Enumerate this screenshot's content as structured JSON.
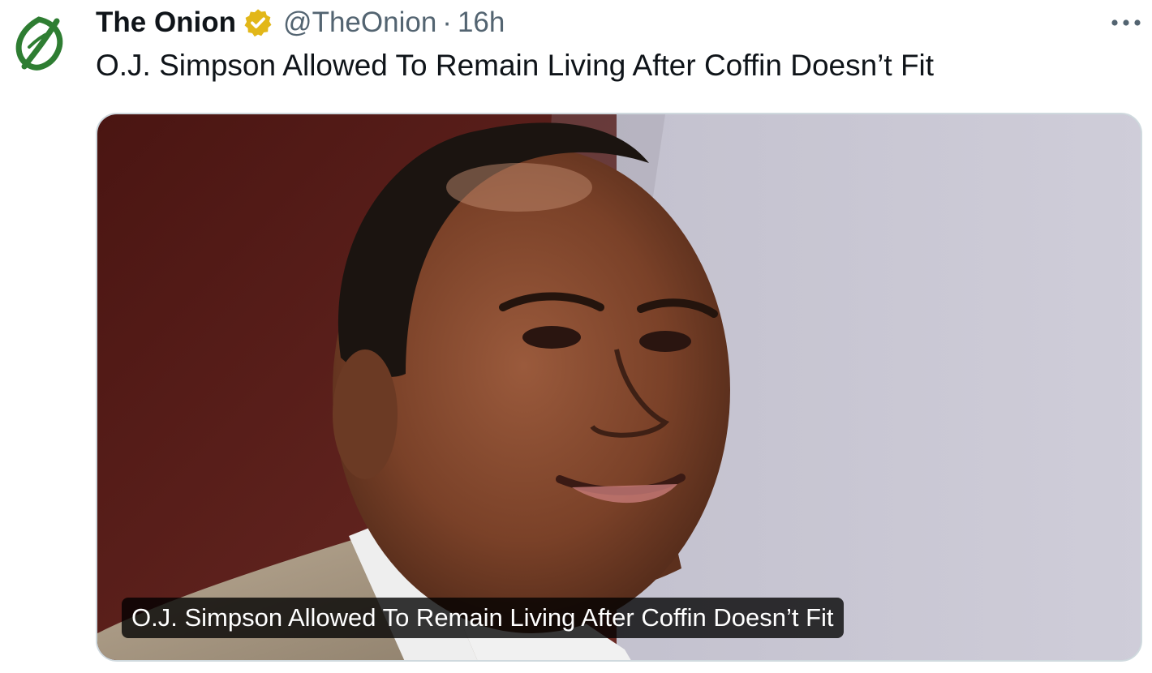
{
  "account": {
    "display_name": "The Onion",
    "handle": "@TheOnion",
    "separator": "·",
    "timestamp": "16h",
    "verified_badge_color": "#e2b719"
  },
  "tweet": {
    "text": "O.J. Simpson Allowed To Remain Living After Coffin Doesn’t Fit"
  },
  "media": {
    "link_caption": "O.J. Simpson Allowed To Remain Living After Coffin Doesn’t Fit"
  },
  "icons": {
    "avatar": "onion-logo-icon",
    "verified": "verified-badge-icon",
    "more": "more-horizontal-icon"
  },
  "colors": {
    "brand_green": "#2e7d32",
    "text_primary": "#0f1419",
    "text_secondary": "#536471"
  }
}
